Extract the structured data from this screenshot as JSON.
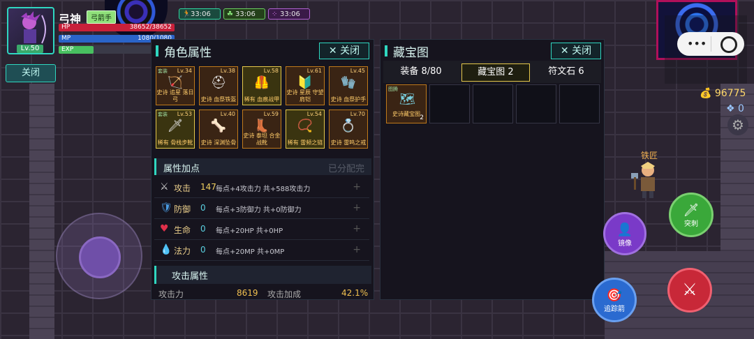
{
  "player": {
    "name": "弓神",
    "class_badge": "弓箭手",
    "level": "Lv.50",
    "hp_label": "HP",
    "hp_value": "38652/38652",
    "mp_label": "MP",
    "mp_value": "1080/1080",
    "exp_label": "EXP",
    "exp_fraction": 0.3
  },
  "buffs": [
    {
      "icon": "runner-icon",
      "time": "33:06",
      "color": "#2a7a5a"
    },
    {
      "icon": "clover-icon",
      "time": "33:06",
      "color": "#3a7a2a"
    },
    {
      "icon": "dots-icon",
      "time": "33:06",
      "color": "#6a2a8a"
    }
  ],
  "close_left_label": "关闭",
  "character_panel": {
    "title": "角色属性",
    "close_label": "关闭",
    "equipment": [
      {
        "tag": "套装",
        "lv": "Lv.34",
        "name": "史诗 追星 落日弓",
        "glyph": "🏹",
        "rare": false
      },
      {
        "tag": "",
        "lv": "Lv.38",
        "name": "史诗 血祭铁盔",
        "glyph": "⛑",
        "rare": false
      },
      {
        "tag": "",
        "lv": "Lv.58",
        "name": "稀有 血痕战甲",
        "glyph": "🦺",
        "rare": true
      },
      {
        "tag": "",
        "lv": "Lv.61",
        "name": "史诗 星辰 守望肩铠",
        "glyph": "🔰",
        "rare": false
      },
      {
        "tag": "",
        "lv": "Lv.45",
        "name": "史诗 血祭护手",
        "glyph": "🧤",
        "rare": false
      },
      {
        "tag": "套装",
        "lv": "Lv.53",
        "name": "稀有 骨栈步靴",
        "glyph": "🗡",
        "rare": true
      },
      {
        "tag": "",
        "lv": "Lv.40",
        "name": "史诗 深渊坠骨",
        "glyph": "🦴",
        "rare": false
      },
      {
        "tag": "",
        "lv": "Lv.59",
        "name": "史诗 泰坦 合金战靴",
        "glyph": "👢",
        "rare": false
      },
      {
        "tag": "",
        "lv": "Lv.54",
        "name": "稀有 雷频之链",
        "glyph": "📿",
        "rare": true
      },
      {
        "tag": "",
        "lv": "Lv.70",
        "name": "史诗 雷鸣之戒",
        "glyph": "💍",
        "rare": false
      }
    ],
    "attr_section": {
      "title": "属性加点",
      "note": "已分配完"
    },
    "stats": [
      {
        "icon": "sword-icon",
        "glyph": "⚔",
        "name": "攻击",
        "value": "147",
        "desc": "每点+4攻击力  共+588攻击力"
      },
      {
        "icon": "shield-icon",
        "glyph": "🛡",
        "name": "防御",
        "value": "0",
        "desc": "每点+3防御力  共+0防御力"
      },
      {
        "icon": "heart-icon",
        "glyph": "♥",
        "name": "生命",
        "value": "0",
        "desc": "每点+20HP  共+0HP"
      },
      {
        "icon": "drop-icon",
        "glyph": "💧",
        "name": "法力",
        "value": "0",
        "desc": "每点+20MP  共+0MP"
      }
    ],
    "attack_section": {
      "title": "攻击属性"
    },
    "attack_row": {
      "label1": "攻击力",
      "value1": "8619",
      "label2": "攻击加成",
      "value2": "42.1%"
    }
  },
  "treasure_panel": {
    "title": "藏宝图",
    "close_label": "关闭",
    "tabs": [
      "装备 8/80",
      "藏宝图 2",
      "符文石 6"
    ],
    "item": {
      "tag": "图腾",
      "name": "史诗藏宝图",
      "count": "2"
    }
  },
  "hud": {
    "gold": "96775",
    "gems": "0",
    "npc_name": "铁匠",
    "skills": [
      {
        "label": "镜像",
        "glyph": "👤"
      },
      {
        "label": "突刺",
        "glyph": "🗡"
      },
      {
        "label": "追踪箭",
        "glyph": "🎯"
      },
      {
        "label": "",
        "glyph": "⚔"
      }
    ]
  }
}
